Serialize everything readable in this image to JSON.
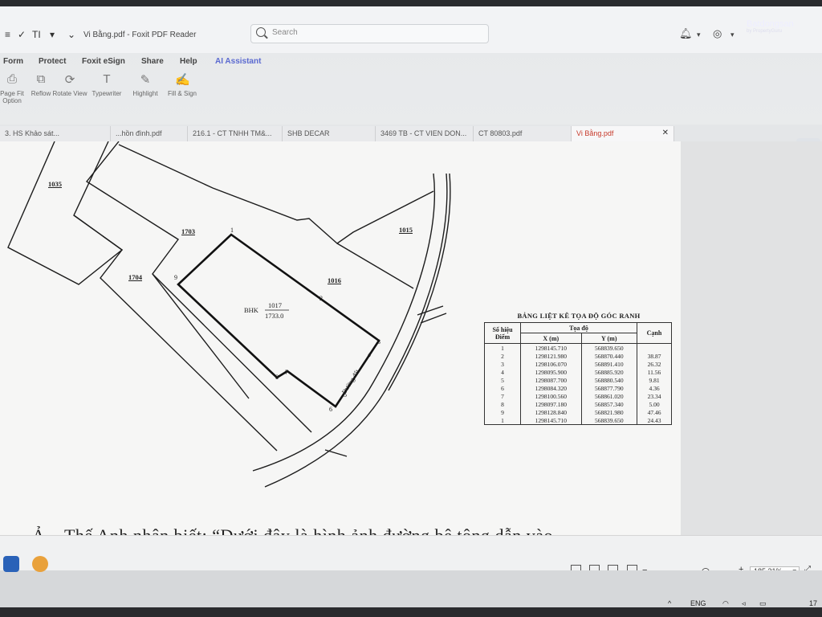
{
  "titlebar": {
    "doc_title": "Vi Bằng.pdf - Foxit PDF Reader",
    "search_placeholder": "Search",
    "watermark": "Batdongsan",
    "watermark_sub": "by PropertyGuru"
  },
  "menu": [
    "Form",
    "Protect",
    "Foxit eSign",
    "Share",
    "Help",
    "AI Assistant"
  ],
  "ribbon": [
    {
      "label": "Page Fit Option",
      "icon": "page-fit-icon"
    },
    {
      "label": "Reflow",
      "icon": "reflow-icon"
    },
    {
      "label": "Rotate View",
      "icon": "rotate-icon"
    },
    {
      "label": "Typewriter",
      "icon": "typewriter-icon"
    },
    {
      "label": "Highlight",
      "icon": "highlight-icon"
    },
    {
      "label": "Fill & Sign",
      "icon": "fill-sign-icon"
    }
  ],
  "tabs": [
    {
      "label": "3. HS Khảo sát..."
    },
    {
      "label": "...hồn đình.pdf"
    },
    {
      "label": "216.1 - CT TNHH TM&..."
    },
    {
      "label": "SHB DECAR"
    },
    {
      "label": "3469 TB - CT VIEN DON..."
    },
    {
      "label": "CT 80803.pdf"
    },
    {
      "label": "Vi Bằng.pdf"
    }
  ],
  "map": {
    "parcels": [
      "1035",
      "1703",
      "1704",
      "1016",
      "1015"
    ],
    "main_parcel_prefix": "BHK",
    "main_parcel_num": "1017",
    "main_parcel_area": "1733.0",
    "road_label": "Đường đất",
    "points": [
      "1",
      "2",
      "3",
      "4",
      "5",
      "6",
      "7",
      "8",
      "9"
    ]
  },
  "coord_table": {
    "title": "BẢNG LIỆT KÊ TỌA ĐỘ GÓC RANH",
    "h_point": "Số hiệu Điểm",
    "h_coord": "Tọa độ",
    "h_x": "X (m)",
    "h_y": "Y (m)",
    "h_edge": "Cạnh",
    "rows": [
      {
        "p": "1",
        "x": "1298145.710",
        "y": "568839.650"
      },
      {
        "p": "2",
        "x": "1298121.980",
        "y": "568870.440"
      },
      {
        "p": "3",
        "x": "1298106.070",
        "y": "568891.410"
      },
      {
        "p": "4",
        "x": "1298095.900",
        "y": "568885.920"
      },
      {
        "p": "5",
        "x": "1298087.700",
        "y": "568880.540"
      },
      {
        "p": "6",
        "x": "1298084.320",
        "y": "568877.790"
      },
      {
        "p": "7",
        "x": "1298100.560",
        "y": "568861.020"
      },
      {
        "p": "8",
        "x": "1298097.180",
        "y": "568857.340"
      },
      {
        "p": "9",
        "x": "1298128.840",
        "y": "568821.980"
      },
      {
        "p": "1",
        "x": "1298145.710",
        "y": "568839.650"
      }
    ],
    "edges": [
      "38.87",
      "26.32",
      "11.56",
      "9.81",
      "4.36",
      "23.34",
      "5.00",
      "47.46",
      "24.43"
    ]
  },
  "caption": "Ả... Thế Anh nhận biết: “Dưới đây là hình ảnh đường bê tông dẫn vào",
  "statusbar": {
    "zoom": "185.31%"
  },
  "taskbar": {
    "lang": "ENG",
    "time": "17"
  }
}
